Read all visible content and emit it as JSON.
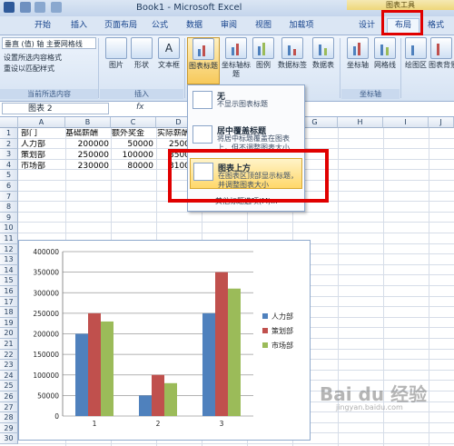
{
  "window": {
    "title": "Book1 - Microsoft Excel",
    "context_tab_title": "图表工具"
  },
  "tabs": [
    {
      "label": "开始"
    },
    {
      "label": "插入"
    },
    {
      "label": "页面布局"
    },
    {
      "label": "公式"
    },
    {
      "label": "数据"
    },
    {
      "label": "审阅"
    },
    {
      "label": "视图"
    },
    {
      "label": "加载项"
    },
    {
      "label": "设计"
    },
    {
      "label": "布局"
    },
    {
      "label": "格式"
    }
  ],
  "ribbon": {
    "current_selection": {
      "dropdown_value": "垂直 (值) 轴 主要网格线",
      "format_selection": "设置所选内容格式",
      "reset_style": "重设以匹配样式",
      "group_label": "当前所选内容"
    },
    "insert": {
      "picture": "图片",
      "shapes": "形状",
      "textbox": "文本框",
      "group_label": "插入"
    },
    "labels": {
      "chart_title": "图表标题",
      "axis_title": "坐标轴标题",
      "legend": "图例",
      "data_labels": "数据标签",
      "data_table": "数据表"
    },
    "axes": {
      "axes": "坐标轴",
      "gridlines": "网格线",
      "group_label": "坐标轴"
    },
    "background": {
      "plot_area": "绘图区",
      "chart_wall": "图表背景"
    }
  },
  "formula_bar": {
    "name_box": "图表 2",
    "fx": "fx"
  },
  "sheet": {
    "columns": [
      "A",
      "B",
      "C",
      "D",
      "E",
      "F",
      "G",
      "H",
      "I",
      "J"
    ],
    "rows": [
      "1",
      "2",
      "3",
      "4",
      "5",
      "6",
      "7",
      "8",
      "9",
      "10",
      "11",
      "12",
      "13",
      "14",
      "15",
      "16",
      "17",
      "18",
      "19",
      "20",
      "21",
      "22",
      "23",
      "24",
      "25",
      "26",
      "27",
      "28",
      "29",
      "30"
    ],
    "cells": {
      "A1": "部门",
      "B1": "基础薪酬",
      "C1": "额外奖金",
      "D1": "实际薪酬",
      "A2": "人力部",
      "B2": "200000",
      "C2": "50000",
      "D2": "2500",
      "A3": "策划部",
      "B3": "250000",
      "C3": "100000",
      "D3": "3500",
      "A4": "市场部",
      "B4": "230000",
      "C4": "80000",
      "D4": "3100"
    }
  },
  "chart_title_menu": {
    "items": [
      {
        "title": "无",
        "desc": "不显示图表标题"
      },
      {
        "title": "居中覆盖标题",
        "desc": "将居中标题覆盖在图表上，但不调整图表大小"
      },
      {
        "title": "图表上方",
        "desc": "在图表区顶部显示标题，并调整图表大小"
      }
    ],
    "more": "其他标题选项(M)..."
  },
  "chart_data": {
    "type": "bar",
    "categories": [
      "1",
      "2",
      "3"
    ],
    "series": [
      {
        "name": "人力部",
        "values": [
          200000,
          50000,
          250000
        ],
        "color": "#4f81bd"
      },
      {
        "name": "策划部",
        "values": [
          250000,
          100000,
          350000
        ],
        "color": "#c0504d"
      },
      {
        "name": "市场部",
        "values": [
          230000,
          80000,
          310000
        ],
        "color": "#9bbb59"
      }
    ],
    "yticks": [
      "0",
      "50000",
      "100000",
      "150000",
      "200000",
      "250000",
      "300000",
      "350000",
      "400000"
    ],
    "ylim": [
      0,
      400000
    ],
    "grid": true,
    "legend": "right"
  },
  "watermark": {
    "brand": "Bai du 经验",
    "url": "jingyan.baidu.com"
  }
}
